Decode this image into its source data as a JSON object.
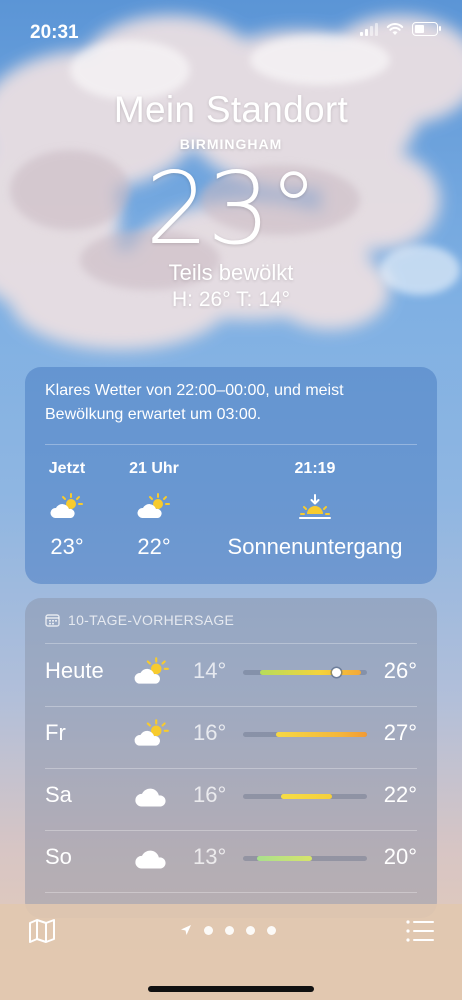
{
  "status": {
    "time": "20:31"
  },
  "hero": {
    "title": "Mein Standort",
    "city": "BIRMINGHAM",
    "temperature": "23°",
    "condition": "Teils bewölkt",
    "hilo": "H: 26°  T: 14°"
  },
  "hourly": {
    "summary": "Klares Wetter von 22:00–00:00, und meist Bewölkung erwartet um 03:00.",
    "items": [
      {
        "label": "Jetzt",
        "icon": "partly-cloudy-sun-icon",
        "value": "23°"
      },
      {
        "label": "21 Uhr",
        "icon": "partly-cloudy-sun-icon",
        "value": "22°"
      },
      {
        "label": "21:19",
        "icon": "sunset-icon",
        "value": "Sonnenuntergang"
      }
    ]
  },
  "forecast": {
    "header": "10-TAGE-VORHERSAGE",
    "days": [
      {
        "day": "Heute",
        "icon": "partly-cloudy-sun-icon",
        "low": "14°",
        "high": "26°",
        "range_start": 0.14,
        "range_end": 0.95,
        "gradient": "linear-gradient(90deg,#b6dc5b,#f5d33b 60%,#f3a83a)",
        "current": 0.75
      },
      {
        "day": "Fr",
        "icon": "partly-cloudy-sun-icon",
        "low": "16°",
        "high": "27°",
        "range_start": 0.27,
        "range_end": 1.0,
        "gradient": "linear-gradient(90deg,#f6d844,#f4b63a 70%,#f29a35)"
      },
      {
        "day": "Sa",
        "icon": "cloud-icon",
        "low": "16°",
        "high": "22°",
        "range_start": 0.31,
        "range_end": 0.72,
        "gradient": "linear-gradient(90deg,#f6dd45,#f5cf3c)"
      },
      {
        "day": "So",
        "icon": "cloud-icon",
        "low": "13°",
        "high": "20°",
        "range_start": 0.11,
        "range_end": 0.56,
        "gradient": "linear-gradient(90deg,#a9e08e,#d7e46a)"
      }
    ]
  },
  "colors": {
    "sun": "#f7cb2e",
    "cloud": "#ffffff",
    "range_track": "#5a647d"
  }
}
